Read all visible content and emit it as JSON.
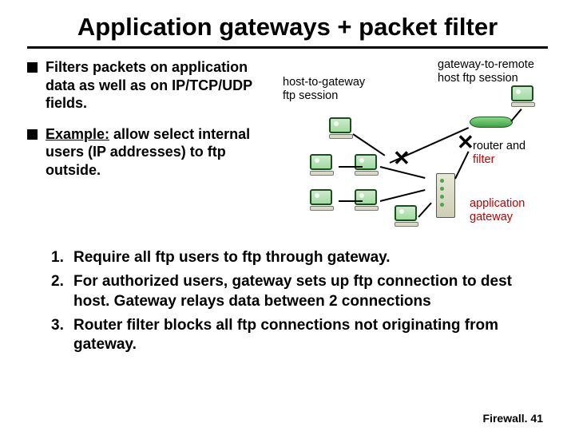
{
  "title": "Application gateways + packet filter",
  "bullets": [
    {
      "text": "Filters packets on application data as well as on IP/TCP/UDP fields."
    },
    {
      "example_label": "Example:",
      "text": " allow select internal users (IP addresses) to ftp outside."
    }
  ],
  "diagram": {
    "label_host_to_gateway_l1": "host-to-gateway",
    "label_host_to_gateway_l2": "ftp session",
    "label_remote_l1": "gateway-to-remote",
    "label_remote_l2": "host ftp session",
    "label_router_filter_router": "router and ",
    "label_router_filter_filter": "filter",
    "label_app_gateway_l1": "application",
    "label_app_gateway_l2": "gateway"
  },
  "steps": [
    {
      "n": "1.",
      "t": "Require all ftp users to ftp through gateway."
    },
    {
      "n": "2.",
      "t": "For authorized users, gateway sets up ftp connection to dest host. Gateway relays data between 2 connections"
    },
    {
      "n": "3.",
      "t": "Router filter blocks all ftp connections not originating from gateway."
    }
  ],
  "footer": "Firewall. 41"
}
